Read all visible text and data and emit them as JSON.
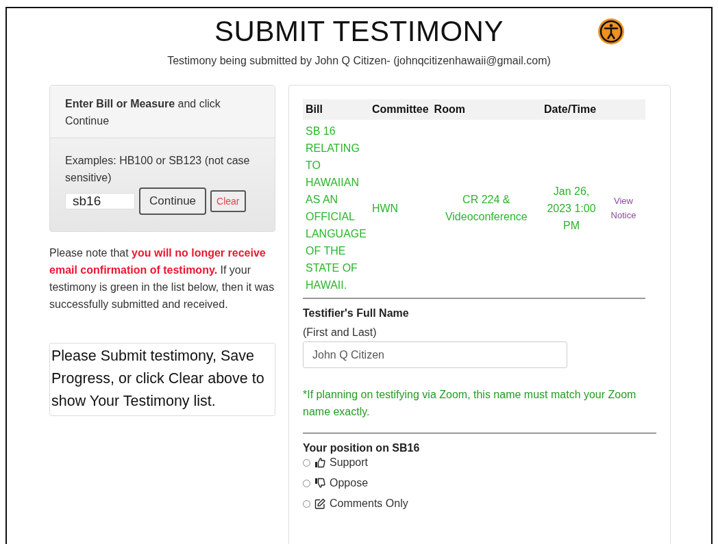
{
  "header": {
    "title": "SUBMIT TESTIMONY",
    "subtitle": "Testimony being submitted by John Q Citizen- (johnqcitizenhawaii@gmail.com)"
  },
  "lookup": {
    "instruction": "**Enter Bill or Measure** and click Continue",
    "examples": "Examples: HB100 or SB123 (not case sensitive)",
    "bill_value": "sb16",
    "continue_button": "Continue",
    "clear_button": "Clear"
  },
  "notice": "Please note that **you will no longer receive email confirmation of testimony.** If your testimony is green in the list below, then it was successfully submitted and received.",
  "prompt": "Please Submit testimony, Save Progress, or click Clear above to show Your Testimony list.",
  "hearing_table": {
    "columns": [
      "Bill",
      "Committee",
      "Room",
      "Date/Time"
    ],
    "rows": [
      {
        "bill": "SB 16 RELATING TO HAWAIIAN AS AN OFFICIAL LANGUAGE OF THE STATE OF HAWAII.",
        "committee": "HWN",
        "room": "CR 224 & Videoconference",
        "date_time": "Jan 26, 2023 1:00 PM",
        "link": "View Notice"
      }
    ]
  },
  "testifier": {
    "label": "Testifier's Full Name",
    "sublabel": "(First and Last)",
    "value": "John Q Citizen",
    "zoom_note": "*If planning on testifying via Zoom, this name must match your Zoom name exactly."
  },
  "position": {
    "label": "Your position on SB16",
    "options": [
      {
        "label": "Support",
        "kind": "thumbs-up",
        "selected": false
      },
      {
        "label": "Oppose",
        "kind": "thumbs-down",
        "selected": false
      },
      {
        "label": "Comments Only",
        "kind": "edit",
        "selected": false
      }
    ]
  }
}
